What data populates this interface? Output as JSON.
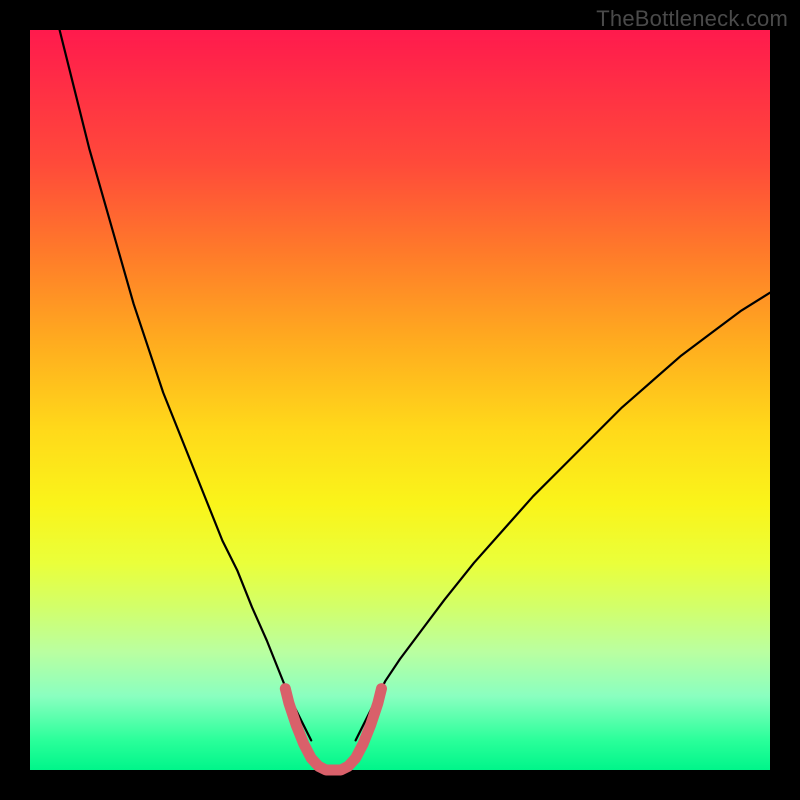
{
  "watermark": "TheBottleneck.com",
  "chart_data": {
    "type": "line",
    "title": "",
    "xlabel": "",
    "ylabel": "",
    "xlim": [
      0,
      100
    ],
    "ylim": [
      0,
      100
    ],
    "grid": false,
    "legend": false,
    "gradient_stops": [
      {
        "pos": 0,
        "color": "#ff1a4d"
      },
      {
        "pos": 18,
        "color": "#ff4a3a"
      },
      {
        "pos": 30,
        "color": "#ff7a2a"
      },
      {
        "pos": 42,
        "color": "#ffab1f"
      },
      {
        "pos": 54,
        "color": "#ffd91a"
      },
      {
        "pos": 64,
        "color": "#faf41a"
      },
      {
        "pos": 72,
        "color": "#eaff3a"
      },
      {
        "pos": 78,
        "color": "#d2ff6a"
      },
      {
        "pos": 84,
        "color": "#baffa0"
      },
      {
        "pos": 90,
        "color": "#8affc0"
      },
      {
        "pos": 96,
        "color": "#2aff9a"
      },
      {
        "pos": 100,
        "color": "#00f58a"
      }
    ],
    "series": [
      {
        "name": "left-limb",
        "color": "#000000",
        "width": 2.2,
        "x": [
          4,
          6,
          8,
          10,
          12,
          14,
          16,
          18,
          20,
          22,
          24,
          26,
          28,
          30,
          32,
          33,
          34,
          35,
          36,
          37,
          38
        ],
        "y": [
          100,
          92,
          84,
          77,
          70,
          63,
          57,
          51,
          46,
          41,
          36,
          31,
          27,
          22,
          17.5,
          15,
          12.5,
          10,
          8,
          6,
          4
        ]
      },
      {
        "name": "valley",
        "color": "#d9606a",
        "width": 11,
        "x": [
          34.5,
          35,
          36,
          37,
          38,
          39,
          40,
          41,
          42,
          43,
          44,
          45,
          46,
          47,
          47.5
        ],
        "y": [
          11,
          9,
          6,
          3.5,
          1.6,
          0.5,
          0,
          0,
          0,
          0.5,
          1.6,
          3.5,
          6,
          9,
          11
        ]
      },
      {
        "name": "right-limb",
        "color": "#000000",
        "width": 2.2,
        "x": [
          44,
          45,
          46,
          47,
          48,
          50,
          53,
          56,
          60,
          64,
          68,
          72,
          76,
          80,
          84,
          88,
          92,
          96,
          100
        ],
        "y": [
          4,
          6,
          8,
          10,
          12,
          15,
          19,
          23,
          28,
          32.5,
          37,
          41,
          45,
          49,
          52.5,
          56,
          59,
          62,
          64.5
        ]
      }
    ]
  }
}
